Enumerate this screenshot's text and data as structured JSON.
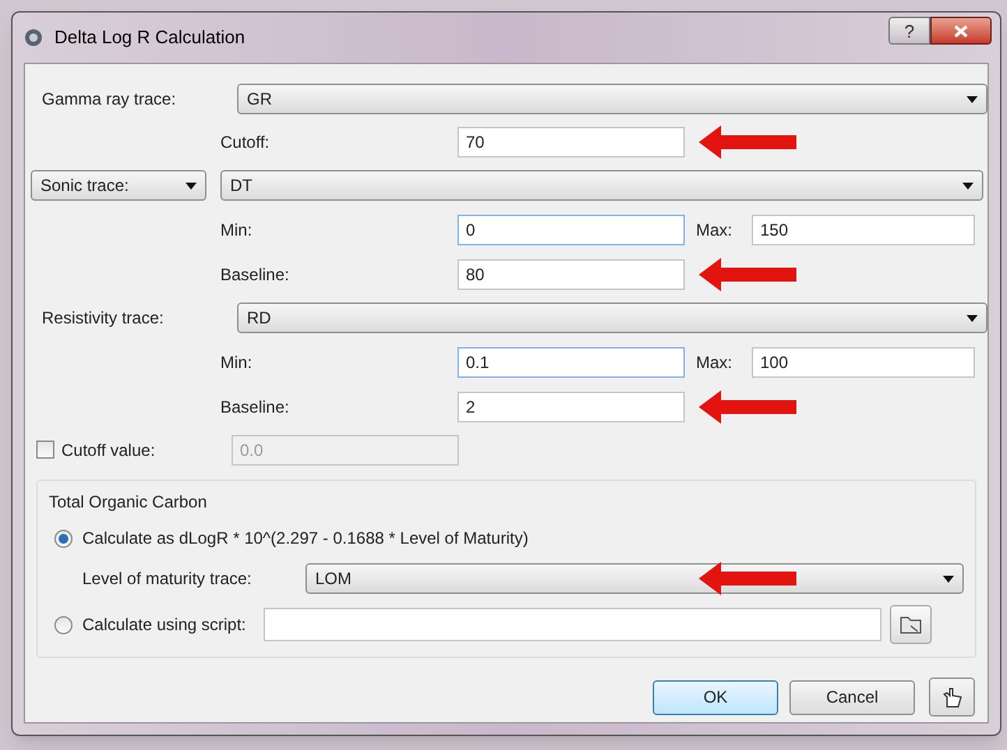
{
  "window": {
    "title": "Delta Log R Calculation",
    "help_button": "?"
  },
  "gamma": {
    "label": "Gamma ray trace:",
    "value": "GR",
    "cutoff": {
      "label": "Cutoff:",
      "value": "70"
    }
  },
  "sonic": {
    "selector": "Sonic trace:",
    "value": "DT",
    "min": {
      "label": "Min:",
      "value": "0"
    },
    "max": {
      "label": "Max:",
      "value": "150"
    },
    "baseline": {
      "label": "Baseline:",
      "value": "80"
    }
  },
  "resistivity": {
    "label": "Resistivity trace:",
    "value": "RD",
    "min": {
      "label": "Min:",
      "value": "0.1"
    },
    "max": {
      "label": "Max:",
      "value": "100"
    },
    "baseline": {
      "label": "Baseline:",
      "value": "2"
    }
  },
  "cutoff_value": {
    "label": "Cutoff value:",
    "checked": false,
    "value": "0.0",
    "disabled": true
  },
  "toc": {
    "title": "Total Organic Carbon",
    "options": [
      {
        "label": "Calculate as dLogR * 10^(2.297 - 0.1688 * Level of Maturity)",
        "selected": true
      },
      {
        "label": "Calculate using script:",
        "selected": false
      }
    ],
    "maturity": {
      "label": "Level of maturity trace:",
      "value": "LOM"
    }
  },
  "buttons": [
    {
      "label": "OK",
      "default": true
    },
    {
      "label": "Cancel",
      "default": false
    }
  ]
}
